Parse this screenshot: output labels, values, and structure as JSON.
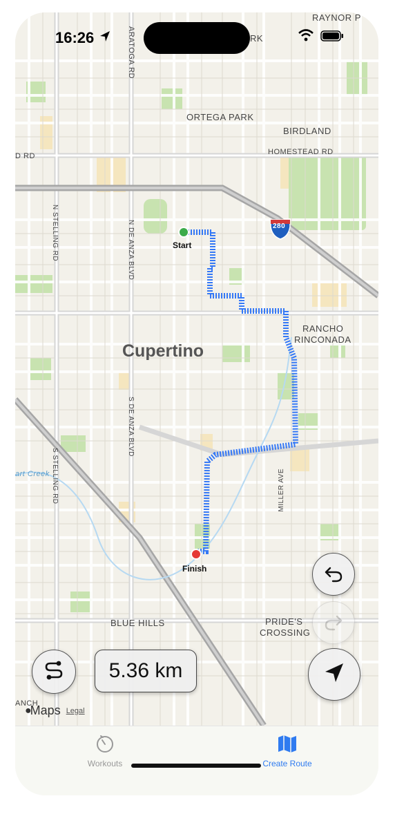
{
  "status_bar": {
    "time": "16:26"
  },
  "map": {
    "city": "Cupertino",
    "labels": [
      "RAYNOR P",
      "ARATOGA RD",
      "RK",
      "ORTEGA PARK",
      "BIRDLAND",
      "D RD",
      "HOMESTEAD RD",
      "280",
      "N STELLING RD",
      "N DE ANZA BLVD",
      "RANCHO",
      "RINCONADA",
      "S DE ANZA BLVD",
      "S STELLING RD",
      "art Creek",
      "MILLER AVE",
      "BLUE HILLS",
      "PRIDE'S",
      "CROSSING",
      "ANCH"
    ],
    "start_label": "Start",
    "finish_label": "Finish",
    "route_color": "#3478f6",
    "start_color": "#3cab4a",
    "finish_color": "#e53935"
  },
  "controls": {
    "route_icon": "route-icon",
    "distance": "5.36 km",
    "undo_icon": "undo-icon",
    "redo_icon": "redo-icon",
    "locate_icon": "location-arrow-icon"
  },
  "attribution": {
    "brand": "Maps",
    "legal": "Legal"
  },
  "tabs": [
    {
      "label": "Workouts",
      "icon": "stopwatch-icon",
      "active": false
    },
    {
      "label": "Create Route",
      "icon": "map-icon",
      "active": true
    }
  ],
  "colors": {
    "accent": "#2f7bf0",
    "inactive": "#999999"
  }
}
